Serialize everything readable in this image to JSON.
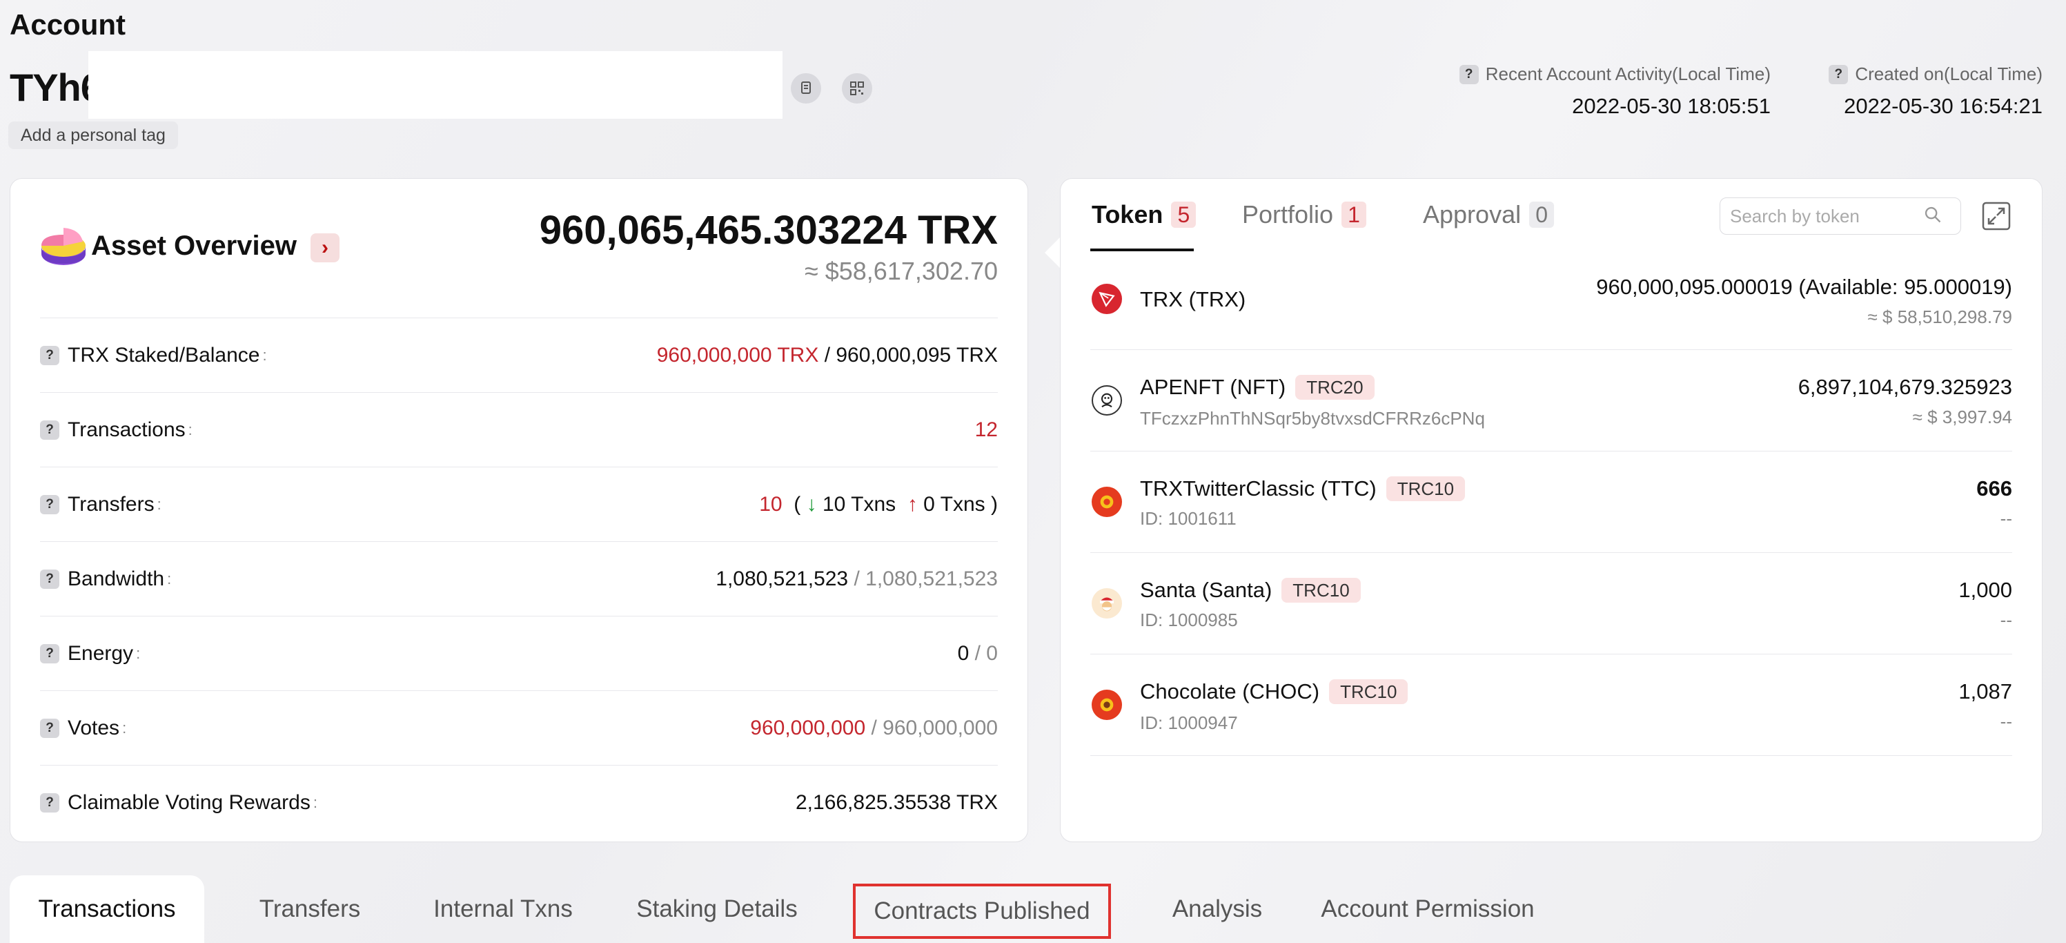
{
  "header": {
    "title": "Account",
    "address_prefix": "TYh6",
    "tag_label": "Add a personal tag",
    "recent_label": "Recent Account Activity(Local Time)",
    "recent_value": "2022-05-30 18:05:51",
    "created_label": "Created on(Local Time)",
    "created_value": "2022-05-30 16:54:21"
  },
  "asset": {
    "title": "Asset Overview",
    "total": "960,065,465.303224 TRX",
    "usd": "≈ $58,617,302.70",
    "rows": {
      "staked": {
        "label": "TRX Staked/Balance",
        "v1": "960,000,000 TRX",
        "v2": "/ 960,000,095 TRX"
      },
      "transactions": {
        "label": "Transactions",
        "v1": "12"
      },
      "transfers": {
        "label": "Transfers",
        "v1": "10",
        "open": "(",
        "in": "10 Txns",
        "out": "0 Txns",
        "close": ")"
      },
      "bandwidth": {
        "label": "Bandwidth",
        "v1": "1,080,521,523",
        "v2": "/ 1,080,521,523"
      },
      "energy": {
        "label": "Energy",
        "v1": "0",
        "v2": "/ 0"
      },
      "votes": {
        "label": "Votes",
        "v1": "960,000,000",
        "v2": "/ 960,000,000"
      },
      "rewards": {
        "label": "Claimable Voting Rewards",
        "v1": "2,166,825.35538 TRX"
      }
    }
  },
  "tokens": {
    "tabs": [
      {
        "label": "Token",
        "count": "5"
      },
      {
        "label": "Portfolio",
        "count": "1"
      },
      {
        "label": "Approval",
        "count": "0"
      }
    ],
    "search_placeholder": "Search by token",
    "items": [
      {
        "name": "TRX (TRX)",
        "type": "",
        "sub": "",
        "amount": "960,000,095.000019 (Available: 95.000019)",
        "usd": "≈ $ 58,510,298.79"
      },
      {
        "name": "APENFT (NFT)",
        "type": "TRC20",
        "sub": "TFczxzPhnThNSqr5by8tvxsdCFRRz6cPNq",
        "amount": "6,897,104,679.325923",
        "usd": "≈ $ 3,997.94"
      },
      {
        "name": "TRXTwitterClassic (TTC)",
        "type": "TRC10",
        "sub": "ID: 1001611",
        "amount": "666",
        "usd": "--"
      },
      {
        "name": "Santa (Santa)",
        "type": "TRC10",
        "sub": "ID: 1000985",
        "amount": "1,000",
        "usd": "--"
      },
      {
        "name": "Chocolate (CHOC)",
        "type": "TRC10",
        "sub": "ID: 1000947",
        "amount": "1,087",
        "usd": "--"
      }
    ]
  },
  "bottom_tabs": [
    "Transactions",
    "Transfers",
    "Internal Txns",
    "Staking Details",
    "Contracts Published",
    "Analysis",
    "Account Permission"
  ],
  "colors": {
    "accent_red": "#c4262e",
    "highlight_border": "#e0322f",
    "green": "#1f9a3a"
  }
}
